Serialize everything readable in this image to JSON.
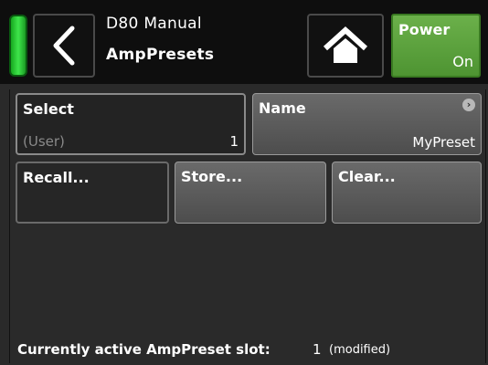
{
  "header": {
    "title_line1": "D80 Manual",
    "title_line2": "AmpPresets",
    "power": {
      "label": "Power",
      "state": "On"
    },
    "back_icon": "chevron-left-icon",
    "home_icon": "home-icon"
  },
  "select": {
    "label": "Select",
    "category": "(User)",
    "value": "1"
  },
  "name": {
    "label": "Name",
    "value": "MyPreset"
  },
  "buttons": {
    "recall": "Recall...",
    "store": "Store...",
    "clear": "Clear..."
  },
  "footer": {
    "label": "Currently active AmpPreset slot:",
    "slot": "1",
    "modified": "(modified)"
  },
  "colors": {
    "status_green": "#3ee54a",
    "power_green": "#5ea23e"
  }
}
